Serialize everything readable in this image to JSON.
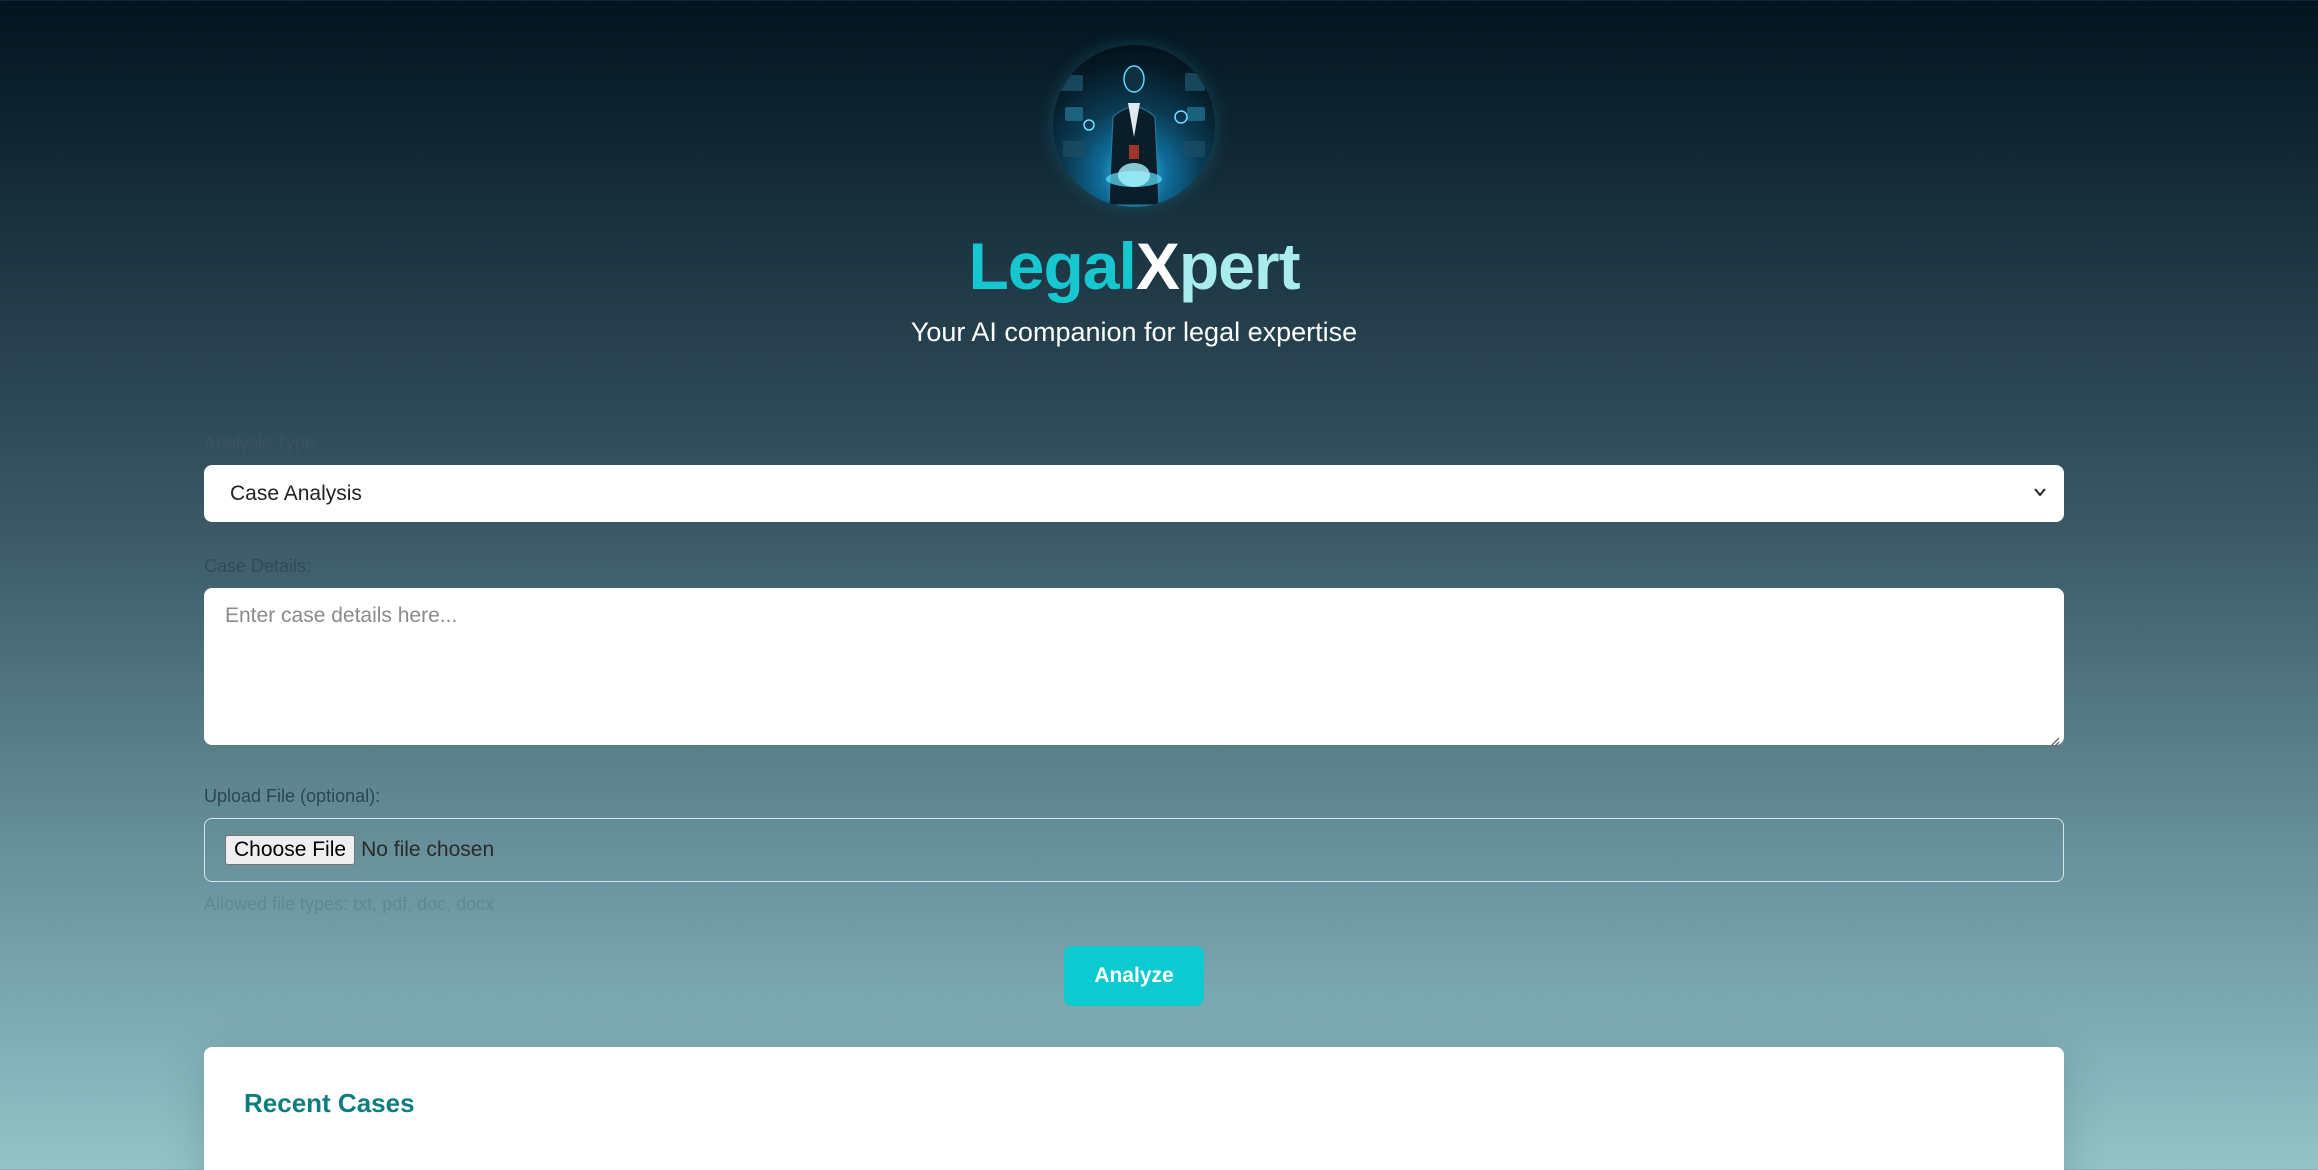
{
  "header": {
    "logo_icon": "ai-lawyer-avatar-icon",
    "brand_part1": "Legal",
    "brand_part2": "X",
    "brand_part3": "pert",
    "tagline": "Your AI companion for legal expertise"
  },
  "form": {
    "analysis_type_label": "Analysis Type:",
    "analysis_type_value": "Case Analysis",
    "case_details_label": "Case Details:",
    "case_details_placeholder": "Enter case details here...",
    "upload_label": "Upload File (optional):",
    "file_button_label": "Choose File",
    "file_status": "No file chosen",
    "allowed_types_hint": "Allowed file types: txt, pdf, doc, docx",
    "analyze_label": "Analyze"
  },
  "recent_cases": {
    "title": "Recent Cases"
  },
  "colors": {
    "accent": "#0ccad0",
    "brand_teal": "#16c7cf",
    "brand_light": "#a9ecef",
    "heading_teal": "#0e7d7e"
  }
}
